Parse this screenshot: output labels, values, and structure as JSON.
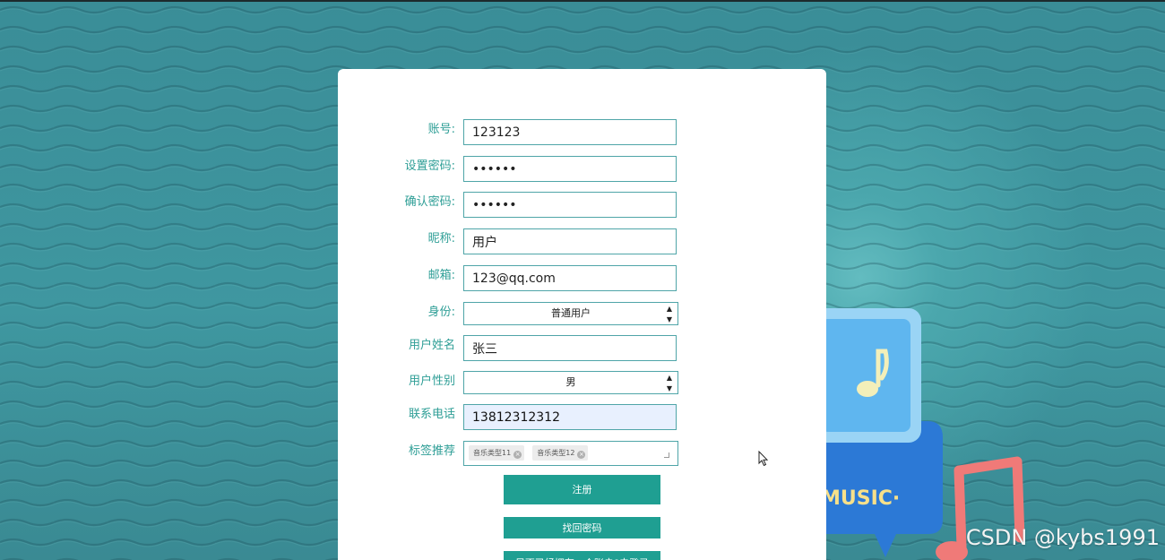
{
  "form": {
    "account": {
      "label": "账号:",
      "value": "123123"
    },
    "password": {
      "label": "设置密码:",
      "value": "••••••"
    },
    "confirm_password": {
      "label": "确认密码:",
      "value": "••••••"
    },
    "nickname": {
      "label": "昵称:",
      "value": "用户"
    },
    "email": {
      "label": "邮箱:",
      "value": "123@qq.com"
    },
    "identity": {
      "label": "身份:",
      "selected": "普通用户"
    },
    "real_name": {
      "label": "用户姓名",
      "value": "张三"
    },
    "gender": {
      "label": "用户性别",
      "selected": "男"
    },
    "phone": {
      "label": "联系电话",
      "value": "13812312312"
    },
    "tags": {
      "label": "标签推荐",
      "items": [
        "音乐类型11",
        "音乐类型12"
      ]
    }
  },
  "buttons": {
    "register": "注册",
    "recover_password": "找回密码",
    "go_login": "是否已经拥有一个账户?去登录"
  },
  "decoration": {
    "music_text": "MUSIC·"
  },
  "watermark": "CSDN @kybs1991",
  "colors": {
    "accent": "#1f9f92",
    "label": "#2e9e96",
    "background": "#3d8f98"
  }
}
